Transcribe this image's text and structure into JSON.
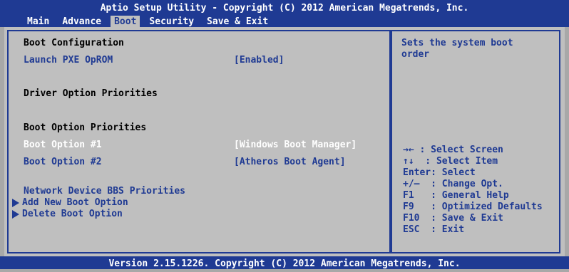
{
  "header": {
    "title": "Aptio Setup Utility - Copyright (C) 2012 American Megatrends, Inc.",
    "tabs": [
      {
        "label": "Main"
      },
      {
        "label": "Advance"
      },
      {
        "label": "Boot"
      },
      {
        "label": "Security"
      },
      {
        "label": "Save & Exit"
      }
    ],
    "active_tab": "Boot"
  },
  "main": {
    "boot_configuration_heading": "Boot Configuration",
    "launch_pxe_label": "Launch PXE OpROM",
    "launch_pxe_value": "[Enabled]",
    "driver_option_priorities_heading": "Driver Option Priorities",
    "boot_option_priorities_heading": "Boot Option Priorities",
    "boot_option_1_label": "Boot Option #1",
    "boot_option_1_value": "[Windows Boot Manager]",
    "boot_option_2_label": "Boot Option #2",
    "boot_option_2_value": "[Atheros Boot Agent]",
    "network_bbs_label": "Network Device BBS Priorities",
    "add_boot_option_label": "Add New Boot Option",
    "delete_boot_option_label": "Delete Boot Option"
  },
  "help": {
    "line1": "Sets the system boot",
    "line2": "order"
  },
  "keys": [
    "→← : Select Screen",
    "↑↓  : Select Item",
    "Enter: Select",
    "+/—  : Change Opt.",
    "F1   : General Help",
    "F9   : Optimized Defaults",
    "F10  : Save & Exit",
    "ESC  : Exit"
  ],
  "footer": {
    "version": "Version 2.15.1226. Copyright (C) 2012 American Megatrends, Inc."
  },
  "colors": {
    "header_bg": "#1f3a93",
    "panel_bg": "#bfbfbf",
    "selected_text": "#ffffff",
    "item_text": "#1f3a93"
  }
}
